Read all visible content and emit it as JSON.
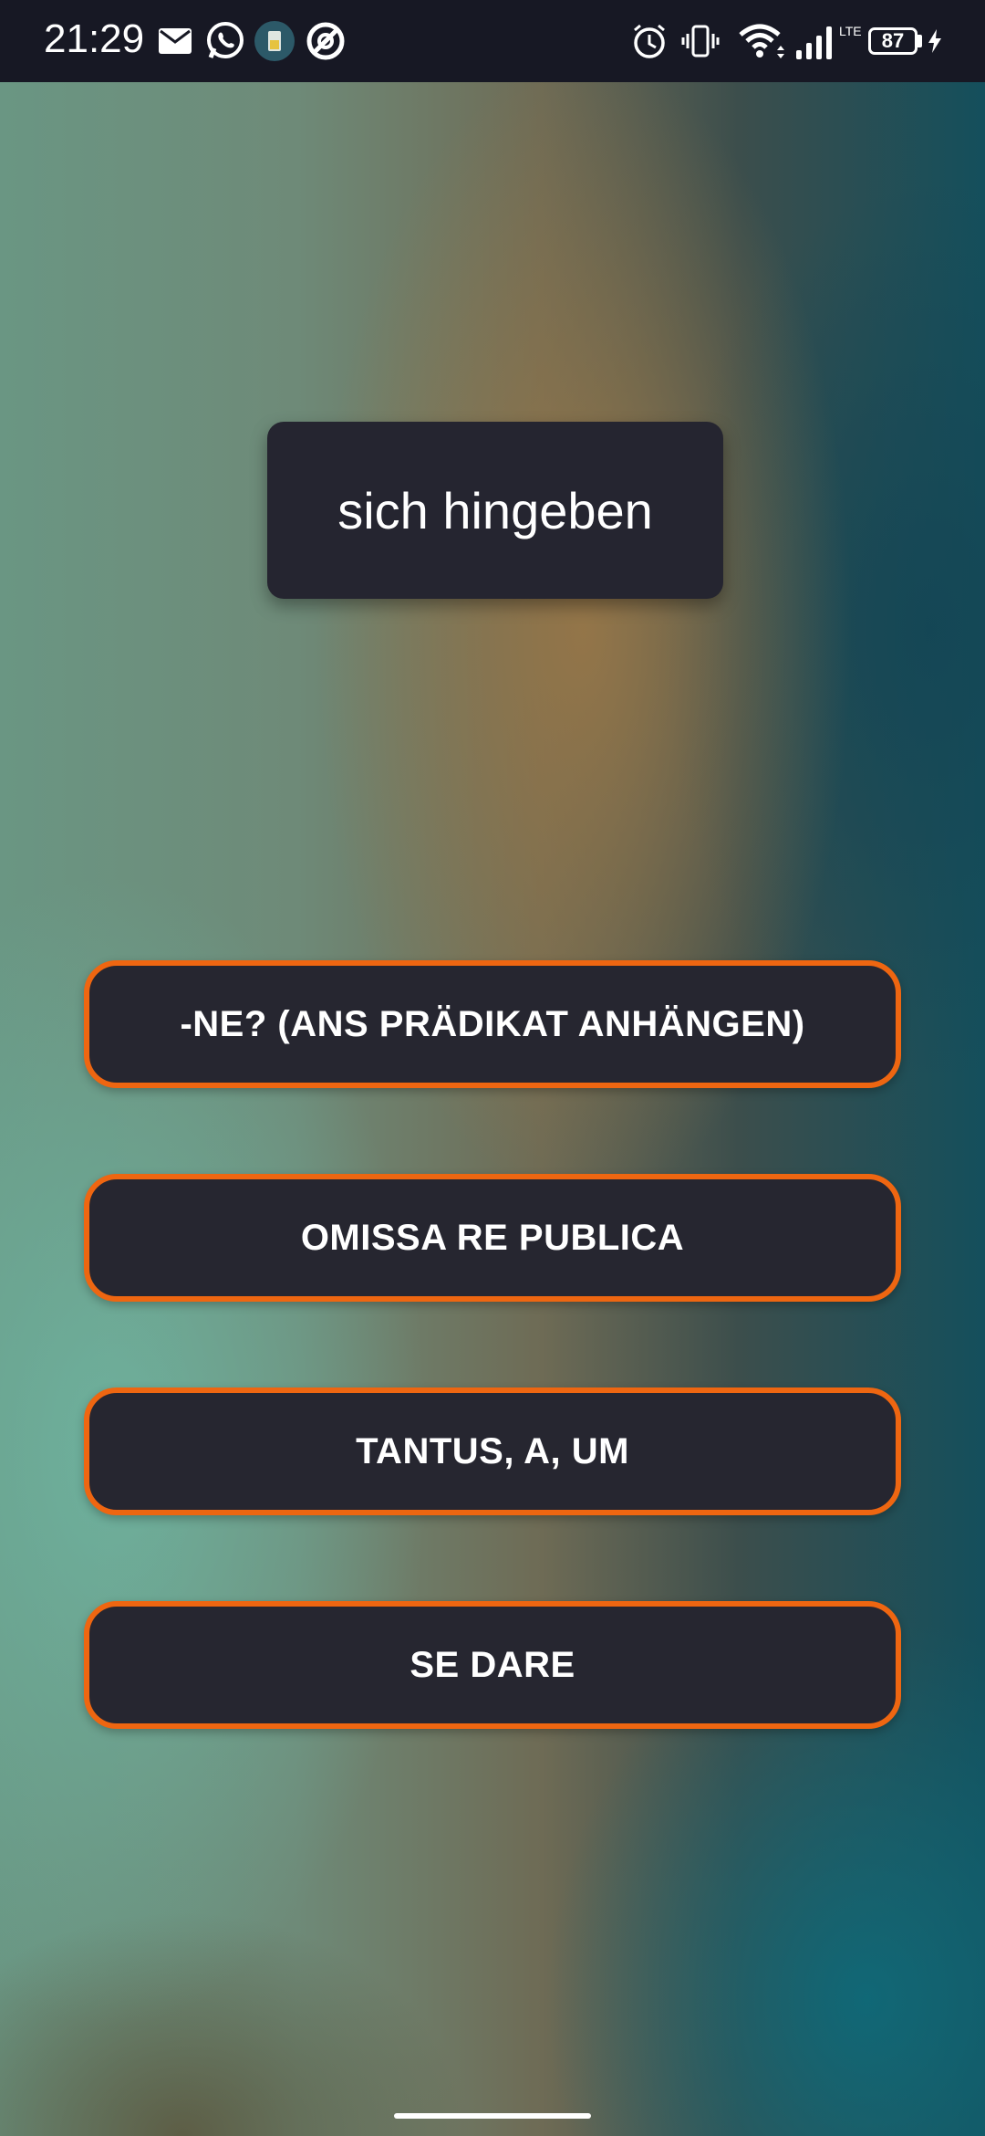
{
  "status_bar": {
    "time": "21:29",
    "battery_level": "87",
    "network_type": "LTE",
    "notification_icons": [
      "mail-icon",
      "whatsapp-icon",
      "app-icon",
      "sync-icon"
    ],
    "system_icons": [
      "alarm-icon",
      "vibrate-icon",
      "wifi-icon",
      "signal-icon",
      "battery-icon",
      "charging-icon"
    ]
  },
  "quiz": {
    "prompt": "sich hingeben",
    "answers": [
      "-NE? (ANS PRÄDIKAT ANHÄNGEN)",
      "OMISSA RE PUBLICA",
      "TANTUS, A, UM",
      "SE DARE"
    ]
  },
  "colors": {
    "button_border": "#ee6611",
    "card_background": "#262630",
    "status_bar": "#171824"
  }
}
